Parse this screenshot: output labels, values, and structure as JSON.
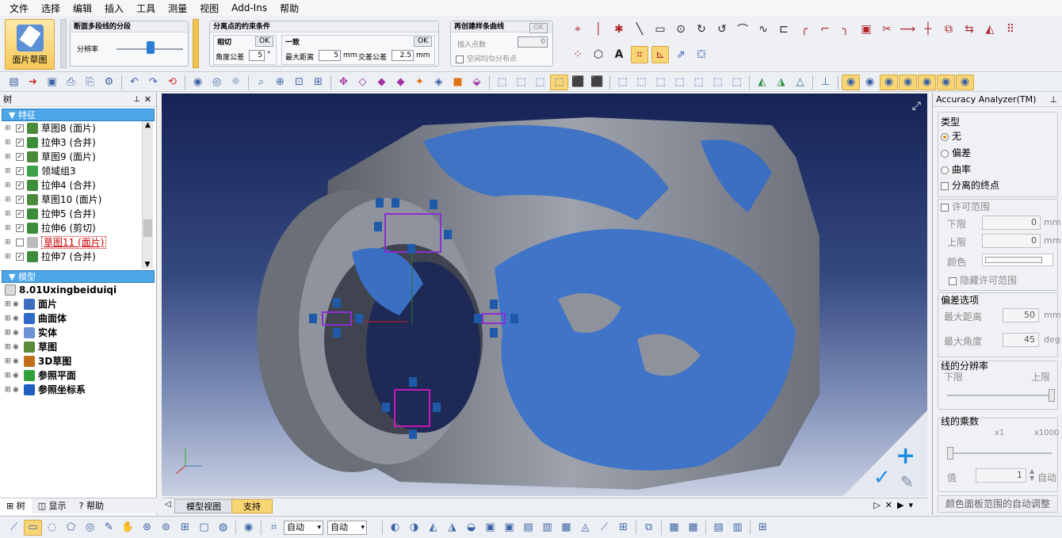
{
  "menu": [
    "文件",
    "选择",
    "编辑",
    "插入",
    "工具",
    "测量",
    "视图",
    "Add-Ins",
    "帮助"
  ],
  "ribbon": {
    "sketch_button": "面片草图",
    "panel1": {
      "title": "断面多段线的分段",
      "resolution_label": "分辨率"
    },
    "panel2": {
      "title": "分离点的约束条件",
      "tangent_label": "相切",
      "ok": "OK",
      "angle_tol_label": "角度公差",
      "angle_tol_value": "5",
      "angle_unit": "°",
      "consistent_label": "一致",
      "max_dist_label": "最大距离",
      "max_dist_value": "5",
      "max_dist_unit": "mm",
      "intersect_tol_label": "交差公差",
      "intersect_tol_value": "2.5",
      "intersect_unit": "mm"
    },
    "panel3": {
      "title": "再创建样条曲线",
      "ok": "OK",
      "insert_label": "插入点数",
      "insert_value": "0",
      "even_label": "空间均匀分布点"
    }
  },
  "left": {
    "title": "树",
    "features_header": "特征",
    "features": [
      {
        "label": "草图8 (面片)",
        "icon": "sketch"
      },
      {
        "label": "拉伸3 (合并)",
        "icon": "extrude"
      },
      {
        "label": "草图9 (面片)",
        "icon": "sketch"
      },
      {
        "label": "领域组3",
        "icon": "region"
      },
      {
        "label": "拉伸4 (合并)",
        "icon": "extrude"
      },
      {
        "label": "草图10 (面片)",
        "icon": "sketch"
      },
      {
        "label": "拉伸5 (合并)",
        "icon": "extrude"
      },
      {
        "label": "拉伸6 (剪切)",
        "icon": "extrude"
      },
      {
        "label": "草图11 (面片)",
        "icon": "sketch",
        "selected": true
      },
      {
        "label": "拉伸7 (合并)",
        "icon": "extrude"
      }
    ],
    "model_header": "模型",
    "model_name": "8.01Uxingbeiduiqi",
    "model_items": [
      "面片",
      "曲面体",
      "实体",
      "草图",
      "3D草图",
      "参照平面",
      "参照坐标系"
    ],
    "bottom_tabs": [
      "树",
      "显示",
      "帮助"
    ]
  },
  "viewport": {
    "tabs": [
      "模型视图",
      "支持"
    ]
  },
  "right": {
    "title": "Accuracy Analyzer(TM)",
    "type_label": "类型",
    "type_options": [
      "无",
      "偏差",
      "曲率"
    ],
    "isolated_label": "分离的终点",
    "tolerance_label": "许可范围",
    "lower_label": "下限",
    "lower_value": "0",
    "upper_label": "上限",
    "upper_value": "0",
    "unit_mm": "mm",
    "color_label": "颜色",
    "hide_tolerance_label": "隐藏许可范围",
    "deviation_options_label": "偏差选项",
    "max_distance_label": "最大距离",
    "max_distance_value": "50",
    "max_angle_label": "最大角度",
    "max_angle_value": "45",
    "unit_deg": "deg",
    "line_resolution_label": "线的分辨率",
    "res_low": "下限",
    "res_high": "上限",
    "line_multiplier_label": "线的乘数",
    "mult_low": "x1",
    "mult_high": "x1000",
    "value_label": "值",
    "value": "1",
    "auto_label": "自动",
    "auto_adjust_label": "颜色面板范围的自动调整"
  },
  "status": {
    "select1": "自动",
    "select2": "自动"
  }
}
